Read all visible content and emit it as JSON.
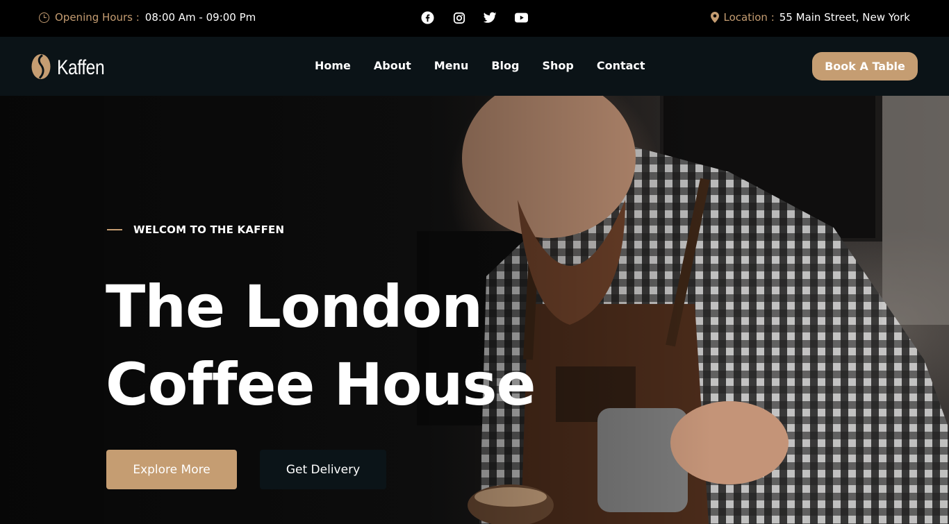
{
  "topbar": {
    "hours_label": "Opening Hours :",
    "hours_value": "08:00 Am - 09:00 Pm",
    "location_label": "Location :",
    "location_value": "55 Main Street, New York",
    "social_icons": [
      "facebook-icon",
      "instagram-icon",
      "twitter-icon",
      "youtube-icon"
    ]
  },
  "nav": {
    "logo_text": "Kaffen",
    "items": [
      {
        "label": "Home"
      },
      {
        "label": "About"
      },
      {
        "label": "Menu"
      },
      {
        "label": "Blog"
      },
      {
        "label": "Shop"
      },
      {
        "label": "Contact"
      }
    ],
    "cta_label": "Book A Table"
  },
  "hero": {
    "eyebrow": "WELCOM TO THE KAFFEN",
    "title_line1": "The London",
    "title_line2": "Coffee House",
    "primary_button": "Explore More",
    "secondary_button": "Get Delivery"
  },
  "colors": {
    "accent": "#c59d72",
    "topbar_bg": "#000000",
    "navbar_bg": "#0b1317",
    "dark_button": "#0b1418"
  }
}
